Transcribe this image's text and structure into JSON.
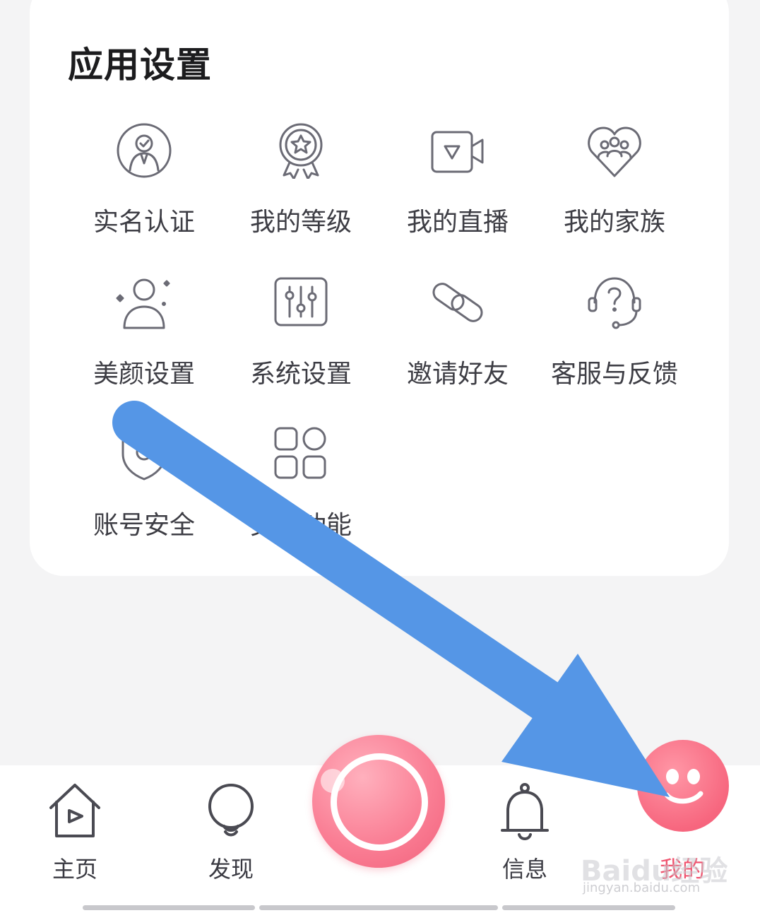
{
  "section": {
    "title": "应用设置"
  },
  "items": [
    {
      "label": "实名认证",
      "icon": "identity-verify-icon"
    },
    {
      "label": "我的等级",
      "icon": "level-badge-icon"
    },
    {
      "label": "我的直播",
      "icon": "live-video-icon"
    },
    {
      "label": "我的家族",
      "icon": "family-heart-icon"
    },
    {
      "label": "美颜设置",
      "icon": "beauty-face-icon"
    },
    {
      "label": "系统设置",
      "icon": "settings-sliders-icon"
    },
    {
      "label": "邀请好友",
      "icon": "invite-link-icon"
    },
    {
      "label": "客服与反馈",
      "icon": "customer-service-icon"
    },
    {
      "label": "账号安全",
      "icon": "shield-icon"
    },
    {
      "label": "更多功能",
      "icon": "more-apps-icon"
    }
  ],
  "tabbar": {
    "tabs": [
      {
        "label": "主页",
        "icon": "home-icon"
      },
      {
        "label": "发现",
        "icon": "discover-bulb-icon"
      },
      {
        "label": "信息",
        "icon": "bell-icon"
      },
      {
        "label": "我的",
        "icon": "smiley-avatar-icon"
      }
    ],
    "active": "我的",
    "center": {
      "icon": "camera-live-icon"
    }
  },
  "watermark": {
    "text": "Baidu经验",
    "sub": "jingyan.baidu.com"
  },
  "colors": {
    "accent": "#f0546f",
    "arrow": "#5596e6",
    "icon_stroke": "#6b6b75",
    "text": "#3d3d44",
    "background": "#f4f4f5",
    "card": "#ffffff"
  }
}
